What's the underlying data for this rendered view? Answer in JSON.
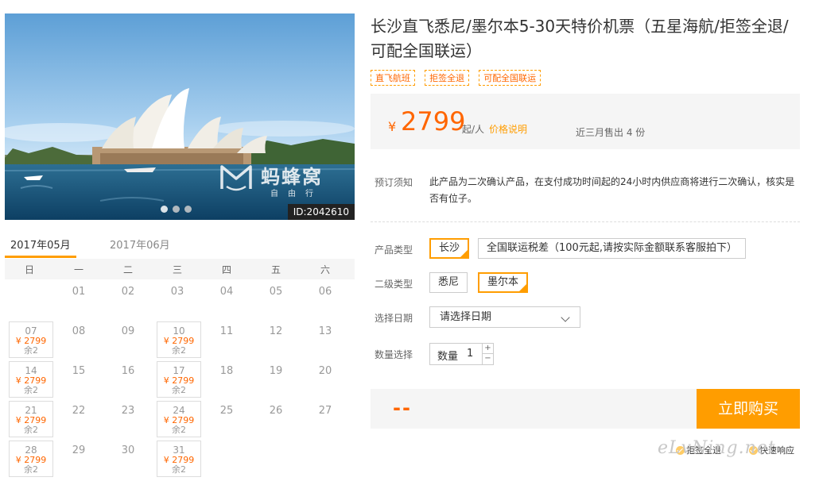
{
  "photo": {
    "watermark_brand": "蚂蜂窝",
    "watermark_sub": "自由行",
    "id_tag": "ID:2042610",
    "slide_count": 3,
    "active_slide": 1
  },
  "calendar": {
    "months": [
      "2017年05月",
      "2017年06月"
    ],
    "active_month": 0,
    "weekdays": [
      "日",
      "一",
      "二",
      "三",
      "四",
      "五",
      "六"
    ],
    "days": [
      {
        "d": "01"
      },
      {
        "d": "02"
      },
      {
        "d": "03"
      },
      {
        "d": "04"
      },
      {
        "d": "05"
      },
      {
        "d": "06"
      },
      {
        "d": "07",
        "price": "¥ 2799",
        "remain": "余2"
      },
      {
        "d": "08"
      },
      {
        "d": "09"
      },
      {
        "d": "10",
        "price": "¥ 2799",
        "remain": "余2"
      },
      {
        "d": "11"
      },
      {
        "d": "12"
      },
      {
        "d": "13"
      },
      {
        "d": "14",
        "price": "¥ 2799",
        "remain": "余2"
      },
      {
        "d": "15"
      },
      {
        "d": "16"
      },
      {
        "d": "17",
        "price": "¥ 2799",
        "remain": "余2"
      },
      {
        "d": "18"
      },
      {
        "d": "19"
      },
      {
        "d": "20"
      },
      {
        "d": "21",
        "price": "¥ 2799",
        "remain": "余2"
      },
      {
        "d": "22"
      },
      {
        "d": "23"
      },
      {
        "d": "24",
        "price": "¥ 2799",
        "remain": "余2"
      },
      {
        "d": "25"
      },
      {
        "d": "26"
      },
      {
        "d": "27"
      },
      {
        "d": "28",
        "price": "¥ 2799",
        "remain": "余2"
      },
      {
        "d": "29"
      },
      {
        "d": "30"
      },
      {
        "d": "31",
        "price": "¥ 2799",
        "remain": "余2"
      }
    ],
    "first_weekday": 1
  },
  "product": {
    "title": "长沙直飞悉尼/墨尔本5-30天特价机票（五星海航/拒签全退/可配全国联运）",
    "tags": [
      "直飞航班",
      "拒签全退",
      "可配全国联运"
    ],
    "currency": "¥",
    "price": "2799",
    "price_unit": "起/人",
    "price_explain": "价格说明",
    "sold_text": "近三月售出 4 份",
    "notice_label": "预订须知",
    "notice_text": "此产品为二次确认产品，在支付成功时间起的24小时内供应商将进行二次确认，核实是否有位子。",
    "type_label": "产品类型",
    "type_options": [
      "长沙",
      "全国联运税差（100元起,请按实际金额联系客服拍下）"
    ],
    "type_selected": 0,
    "subtype_label": "二级类型",
    "subtype_options": [
      "悉尼",
      "墨尔本"
    ],
    "subtype_selected": 1,
    "date_label": "选择日期",
    "date_placeholder": "请选择日期",
    "qty_label": "数量选择",
    "qty_inner_label": "数量",
    "qty_value": "1",
    "qty_plus": "+",
    "qty_minus": "−",
    "total": "--",
    "buy_label": "立即购买",
    "guarantees": [
      "拒签全退",
      "快速响应"
    ],
    "site_watermark": "eLvNing.net"
  },
  "colors": {
    "accent": "#ff9d00",
    "price": "#ff6600",
    "panel_bg": "#f5f5f5"
  }
}
